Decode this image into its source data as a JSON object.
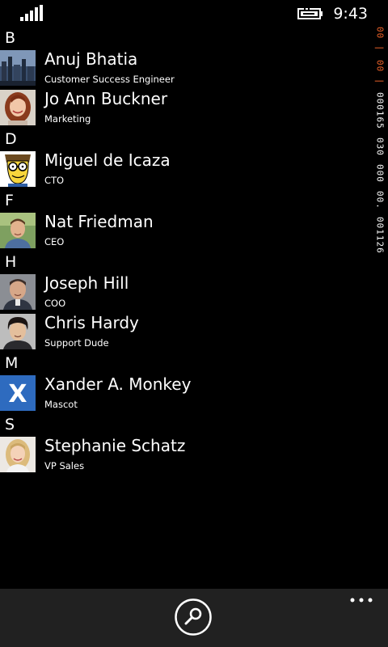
{
  "status_bar": {
    "time": "9:43",
    "signal_icon": "signal-bars-icon",
    "battery_icon": "battery-charging-icon"
  },
  "contacts": {
    "groups": [
      {
        "letter": "B",
        "items": [
          {
            "name": "Anuj Bhatia",
            "title": "Customer Success Engineer",
            "avatar": "city-skyline-photo"
          },
          {
            "name": "Jo Ann Buckner",
            "title": "Marketing",
            "avatar": "woman-portrait-photo"
          }
        ]
      },
      {
        "letter": "D",
        "items": [
          {
            "name": "Miguel de Icaza",
            "title": "CTO",
            "avatar": "cartoon-glasses-avatar"
          }
        ]
      },
      {
        "letter": "F",
        "items": [
          {
            "name": "Nat Friedman",
            "title": "CEO",
            "avatar": "man-outdoor-portrait-photo"
          }
        ]
      },
      {
        "letter": "H",
        "items": [
          {
            "name": "Joseph Hill",
            "title": "COO",
            "avatar": "man-portrait-photo"
          },
          {
            "name": "Chris Hardy",
            "title": "Support Dude",
            "avatar": "man-dark-hair-photo"
          }
        ]
      },
      {
        "letter": "M",
        "items": [
          {
            "name": "Xander A. Monkey",
            "title": "Mascot",
            "avatar": "xamarin-x-logo"
          }
        ]
      },
      {
        "letter": "S",
        "items": [
          {
            "name": "Stephanie Schatz",
            "title": "VP Sales",
            "avatar": "woman-blonde-portrait-photo"
          }
        ]
      }
    ]
  },
  "debug_overlay": {
    "accent_color": "#f0642a",
    "chunks": [
      {
        "text": "00 |",
        "accent": true
      },
      {
        "text": "00 |",
        "accent": true
      },
      {
        "text": "000165",
        "accent": false
      },
      {
        "text": "030",
        "accent": false
      },
      {
        "text": "000",
        "accent": false
      },
      {
        "text": "00.",
        "accent": false
      },
      {
        "text": "001126",
        "accent": false
      }
    ]
  },
  "app_bar": {
    "search_icon": "search-icon",
    "more_icon": "ellipsis-icon",
    "background": "#212121"
  }
}
